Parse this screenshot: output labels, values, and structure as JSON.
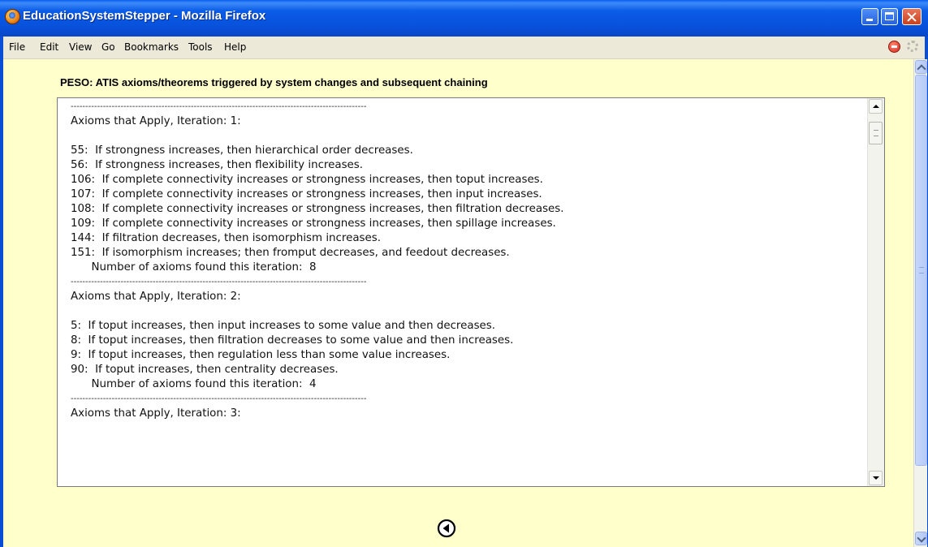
{
  "window": {
    "title": "EducationSystemStepper - Mozilla Firefox"
  },
  "menu": {
    "items": [
      "File",
      "Edit",
      "View",
      "Go",
      "Bookmarks",
      "Tools",
      "Help"
    ]
  },
  "page": {
    "heading": "PESO:  ATIS axioms/theorems triggered by system changes and subsequent chaining",
    "lines": [
      "-----------------------------------------------------------------------------------------------------",
      "Axioms that Apply, Iteration: 1:",
      "",
      "55:  If strongness increases, then hierarchical order decreases.",
      "56:  If strongness increases, then flexibility increases.",
      "106:  If complete connectivity increases or strongness increases, then toput increases.",
      "107:  If complete connectivity increases or strongness increases, then input increases.",
      "108:  If complete connectivity increases or strongness increases, then filtration decreases.",
      "109:  If complete connectivity increases or strongness increases, then spillage increases.",
      "144:  If filtration decreases, then isomorphism increases.",
      "151:  If isomorphism increases; then fromput decreases, and feedout decreases.",
      "      Number of axioms found this iteration:  8",
      "-----------------------------------------------------------------------------------------------------",
      "Axioms that Apply, Iteration: 2:",
      "",
      "5:  If toput increases, then input increases to some value and then decreases.",
      "8:  If toput increases, then filtration decreases to some value and then increases.",
      "9:  If toput increases, then regulation less than some value increases.",
      "90:  If toput increases, then centrality decreases.",
      "      Number of axioms found this iteration:  4",
      "-----------------------------------------------------------------------------------------------------",
      "Axioms that Apply, Iteration: 3:"
    ]
  },
  "icons": {
    "app": "firefox-icon",
    "stop": "stop-icon",
    "throbber": "throbber-icon",
    "next": "circled-arrow-left-icon"
  }
}
